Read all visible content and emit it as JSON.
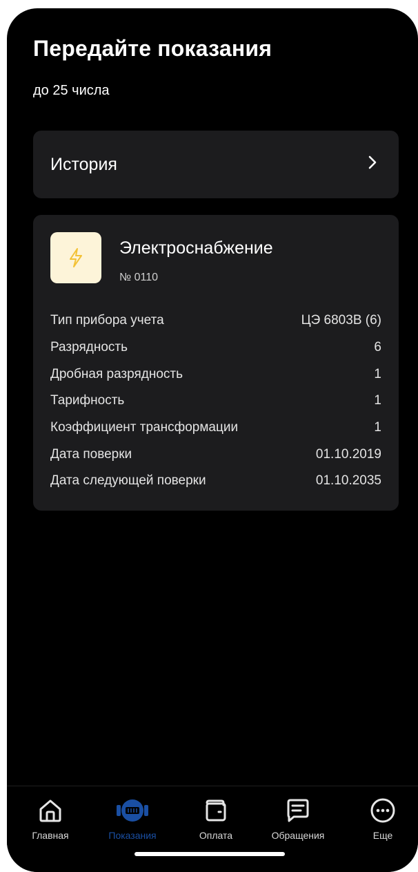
{
  "header": {
    "title": "Передайте показания",
    "subtitle": "до 25 числа"
  },
  "history": {
    "label": "История",
    "icon": "chevron-right-icon"
  },
  "meter": {
    "icon": "lightning-icon",
    "icon_bg": "#fdf4d9",
    "icon_color": "#f3c237",
    "name": "Электроснабжение",
    "number": "№ 0110",
    "props": [
      {
        "label": "Тип прибора учета",
        "value": "ЦЭ 6803В (6)"
      },
      {
        "label": "Разрядность",
        "value": "6"
      },
      {
        "label": "Дробная разрядность",
        "value": "1"
      },
      {
        "label": "Тарифность",
        "value": "1"
      },
      {
        "label": "Коэффициент трансформации",
        "value": "1"
      },
      {
        "label": "Дата поверки",
        "value": "01.10.2019"
      },
      {
        "label": "Дата следующей поверки",
        "value": "01.10.2035"
      }
    ]
  },
  "tabbar": {
    "active_color": "#1a4fa3",
    "items": [
      {
        "label": "Главная",
        "icon": "home-icon",
        "active": false
      },
      {
        "label": "Показания",
        "icon": "meter-icon",
        "active": true
      },
      {
        "label": "Оплата",
        "icon": "wallet-icon",
        "active": false
      },
      {
        "label": "Обращения",
        "icon": "message-icon",
        "active": false
      },
      {
        "label": "Еще",
        "icon": "more-icon",
        "active": false
      }
    ]
  }
}
